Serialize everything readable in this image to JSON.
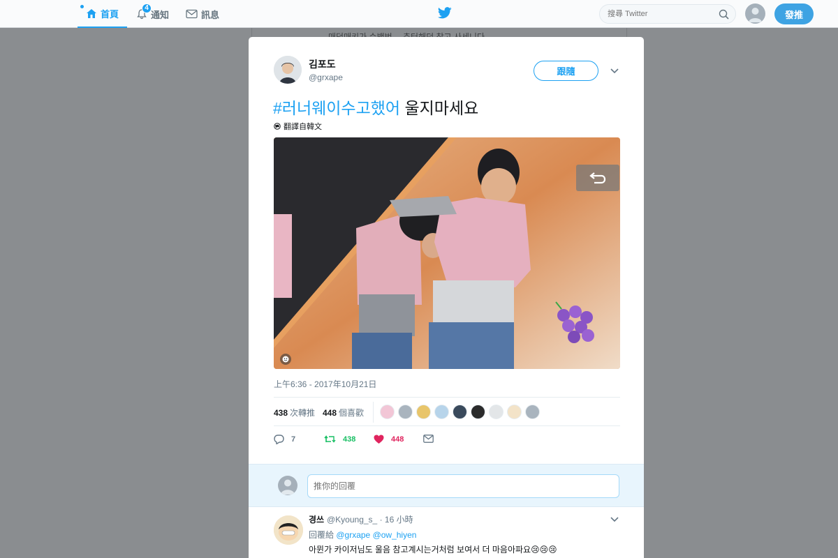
{
  "nav": {
    "home_label": "首頁",
    "notifications_label": "通知",
    "notifications_count": "4",
    "messages_label": "訊息",
    "search_placeholder": "搜尋 Twitter",
    "tweet_button": "發推"
  },
  "background": {
    "text": "매덕매키가 수백번… 추터해던 참고 사세니다"
  },
  "tweet": {
    "author_name": "김포도",
    "author_handle": "@grxape",
    "follow_label": "跟隨",
    "hashtag": "#러너웨이수고했어",
    "text_rest": " 울지마세요",
    "translate_label": "翻譯自韓文",
    "timestamp": "上午6:36 - 2017年10月21日",
    "retweets_count": "438",
    "retweets_label": "次轉推",
    "likes_count": "448",
    "likes_label": "個喜歡",
    "reply_count": "7",
    "retweet_action_count": "438",
    "like_action_count": "448"
  },
  "reply_box": {
    "placeholder": "推你的回覆"
  },
  "comment": {
    "name": "경쓰",
    "meta": "@Kyoung_s_ · 16 小時",
    "replying_prefix": "回覆給",
    "replying_mentions": "@grxape @ow_hiyen",
    "text": "아뮌가 카이저님도 울음 참고계시는거처럼 보여서 더 마음아파요😢😢😢"
  },
  "colors": {
    "brand": "#1da1f2",
    "retweet": "#17bf63",
    "like": "#e0245e"
  },
  "likers": [
    "#f2c6d6",
    "#a9b4be",
    "#e8c56a",
    "#b7d4ea",
    "#3a4a5c",
    "#2b2b2b",
    "#e3e6e8",
    "#f3e3c8",
    "#a9b4be"
  ]
}
